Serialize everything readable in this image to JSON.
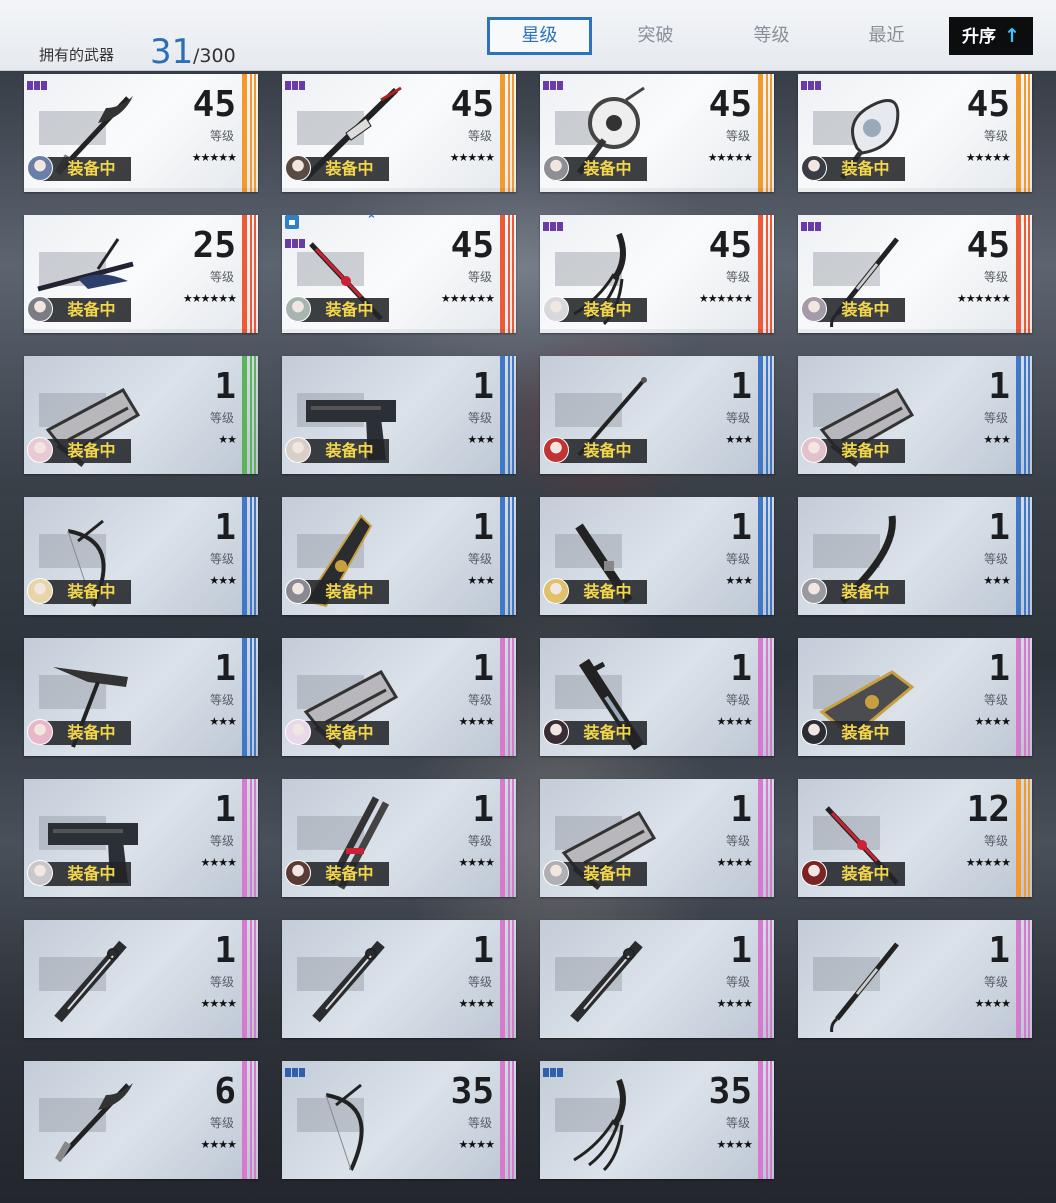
{
  "header": {
    "owned_label": "拥有的武器",
    "owned_count": "31",
    "owned_max": "/300",
    "sort_tabs": [
      {
        "label": "星级",
        "active": true
      },
      {
        "label": "突破",
        "active": false
      },
      {
        "label": "等级",
        "active": false
      },
      {
        "label": "最近",
        "active": false
      }
    ],
    "order_button": {
      "label": "升序",
      "icon": "arrow-up-icon"
    }
  },
  "colors": {
    "orange": "#f39a2b",
    "red": "#ee5a35",
    "blue": "#3f78c9",
    "pink": "#d679cf",
    "green": "#5cb35a",
    "accent": "#2d72bd",
    "equip_text": "#f3d64a"
  },
  "level_label": "等级",
  "equip_label": "装备中",
  "weapons": [
    {
      "level": "45",
      "stars": "★★★★★",
      "rarity": "orange",
      "equipped": true,
      "badge": "purple",
      "weapon_icon": "lance"
    },
    {
      "level": "45",
      "stars": "★★★★★",
      "rarity": "orange",
      "equipped": true,
      "badge": "purple",
      "weapon_icon": "sword"
    },
    {
      "level": "45",
      "stars": "★★★★★",
      "rarity": "orange",
      "equipped": true,
      "badge": "purple",
      "weapon_icon": "shield"
    },
    {
      "level": "45",
      "stars": "★★★★★",
      "rarity": "orange",
      "equipped": true,
      "badge": "purple",
      "weapon_icon": "device"
    },
    {
      "level": "25",
      "stars": "★★★★★★",
      "rarity": "red",
      "equipped": true,
      "badge": "",
      "weapon_icon": "glaive"
    },
    {
      "level": "45",
      "stars": "★★★★★★",
      "rarity": "red",
      "equipped": true,
      "badge": "purple",
      "locked": true,
      "weapon_icon": "katana"
    },
    {
      "level": "45",
      "stars": "★★★★★★",
      "rarity": "red",
      "equipped": true,
      "badge": "purple",
      "weapon_icon": "claw"
    },
    {
      "level": "45",
      "stars": "★★★★★★",
      "rarity": "red",
      "equipped": true,
      "badge": "purple",
      "weapon_icon": "spear"
    },
    {
      "level": "1",
      "stars": "★★",
      "rarity": "green",
      "equipped": true,
      "badge": "",
      "weapon_icon": "cannon"
    },
    {
      "level": "1",
      "stars": "★★★",
      "rarity": "blue",
      "equipped": true,
      "badge": "",
      "weapon_icon": "pistol"
    },
    {
      "level": "1",
      "stars": "★★★",
      "rarity": "blue",
      "equipped": true,
      "badge": "",
      "weapon_icon": "rod"
    },
    {
      "level": "1",
      "stars": "★★★",
      "rarity": "blue",
      "equipped": true,
      "badge": "",
      "weapon_icon": "cannon"
    },
    {
      "level": "1",
      "stars": "★★★",
      "rarity": "blue",
      "equipped": true,
      "badge": "",
      "weapon_icon": "bow"
    },
    {
      "level": "1",
      "stars": "★★★",
      "rarity": "blue",
      "equipped": true,
      "badge": "",
      "weapon_icon": "blade"
    },
    {
      "level": "1",
      "stars": "★★★",
      "rarity": "blue",
      "equipped": true,
      "badge": "",
      "weapon_icon": "knife"
    },
    {
      "level": "1",
      "stars": "★★★",
      "rarity": "blue",
      "equipped": true,
      "badge": "",
      "weapon_icon": "sabre"
    },
    {
      "level": "1",
      "stars": "★★★",
      "rarity": "blue",
      "equipped": true,
      "badge": "",
      "weapon_icon": "scythe"
    },
    {
      "level": "1",
      "stars": "★★★★",
      "rarity": "pink",
      "equipped": true,
      "badge": "",
      "weapon_icon": "cannon"
    },
    {
      "level": "1",
      "stars": "★★★★",
      "rarity": "pink",
      "equipped": true,
      "badge": "",
      "weapon_icon": "greatsword"
    },
    {
      "level": "1",
      "stars": "★★★★",
      "rarity": "pink",
      "equipped": true,
      "badge": "",
      "weapon_icon": "gauntlet"
    },
    {
      "level": "1",
      "stars": "★★★★",
      "rarity": "pink",
      "equipped": true,
      "badge": "",
      "weapon_icon": "pistol"
    },
    {
      "level": "1",
      "stars": "★★★★",
      "rarity": "pink",
      "equipped": true,
      "badge": "",
      "weapon_icon": "twin"
    },
    {
      "level": "1",
      "stars": "★★★★",
      "rarity": "pink",
      "equipped": true,
      "badge": "",
      "weapon_icon": "cannon"
    },
    {
      "level": "12",
      "stars": "★★★★★",
      "rarity": "orange",
      "equipped": true,
      "badge": "",
      "weapon_icon": "katana"
    },
    {
      "level": "1",
      "stars": "★★★★",
      "rarity": "pink",
      "equipped": false,
      "badge": "",
      "weapon_icon": "sheath"
    },
    {
      "level": "1",
      "stars": "★★★★",
      "rarity": "pink",
      "equipped": false,
      "badge": "",
      "weapon_icon": "sheath"
    },
    {
      "level": "1",
      "stars": "★★★★",
      "rarity": "pink",
      "equipped": false,
      "badge": "",
      "weapon_icon": "sheath"
    },
    {
      "level": "1",
      "stars": "★★★★",
      "rarity": "pink",
      "equipped": false,
      "badge": "",
      "weapon_icon": "spear"
    },
    {
      "level": "6",
      "stars": "★★★★",
      "rarity": "pink",
      "equipped": false,
      "badge": "",
      "weapon_icon": "lance"
    },
    {
      "level": "35",
      "stars": "★★★★",
      "rarity": "pink",
      "equipped": false,
      "badge": "blue",
      "weapon_icon": "bow"
    },
    {
      "level": "35",
      "stars": "★★★★",
      "rarity": "pink",
      "equipped": false,
      "badge": "blue",
      "weapon_icon": "claw"
    }
  ]
}
